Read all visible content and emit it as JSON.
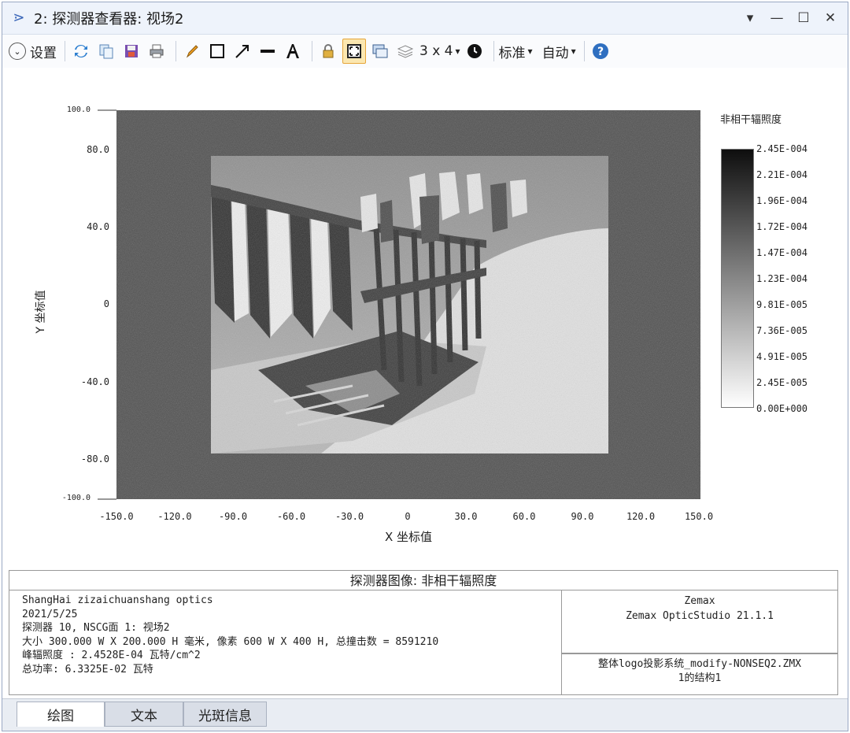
{
  "window": {
    "title": "2: 探测器查看器: 视场2",
    "controls": [
      "▾",
      "—",
      "☐",
      "✕"
    ]
  },
  "toolbar": {
    "settings_label": "设置",
    "layout_label": "3 x 4",
    "standard_label": "标准",
    "auto_label": "自动",
    "dropdown_arrow": "▾"
  },
  "plot": {
    "x_ticks": [
      "-150.0",
      "-120.0",
      "-90.0",
      "-60.0",
      "-30.0",
      "0",
      "30.0",
      "60.0",
      "90.0",
      "120.0",
      "150.0"
    ],
    "y_ticks": [
      "100.0",
      "80.0",
      "40.0",
      "0",
      "-40.0",
      "-80.0",
      "-100.0"
    ],
    "x_label": "X 坐标值",
    "y_label": "Y 坐标值",
    "xlim": [
      -150,
      150
    ],
    "ylim": [
      -100,
      100
    ]
  },
  "colorbar": {
    "title": "非相干辐照度",
    "ticks": [
      "2.45E-004",
      "2.21E-004",
      "1.96E-004",
      "1.72E-004",
      "1.47E-004",
      "1.23E-004",
      "9.81E-005",
      "7.36E-005",
      "4.91E-005",
      "2.45E-005",
      "0.00E+000"
    ],
    "gradient_colors": [
      "#0e0e0e",
      "#ffffff"
    ]
  },
  "info": {
    "title": "探测器图像: 非相干辐照度",
    "left_lines": [
      "ShangHai zizaichuanshang optics",
      "2021/5/25",
      "探测器 10, NSCG面 1: 视场2",
      "大小 300.000 W X 200.000 H 毫米, 像素 600 W X 400 H, 总撞击数 = 8591210",
      "峰辐照度 : 2.4528E-04 瓦特/cm^2",
      "总功率: 6.3325E-02 瓦特"
    ],
    "company": "Zemax",
    "product": "Zemax OpticStudio 21.1.1",
    "file_line1": "整体logo投影系统_modify-NONSEQ2.ZMX",
    "file_line2": "1的结构1"
  },
  "tabs": [
    "绘图",
    "文本",
    "光斑信息"
  ]
}
